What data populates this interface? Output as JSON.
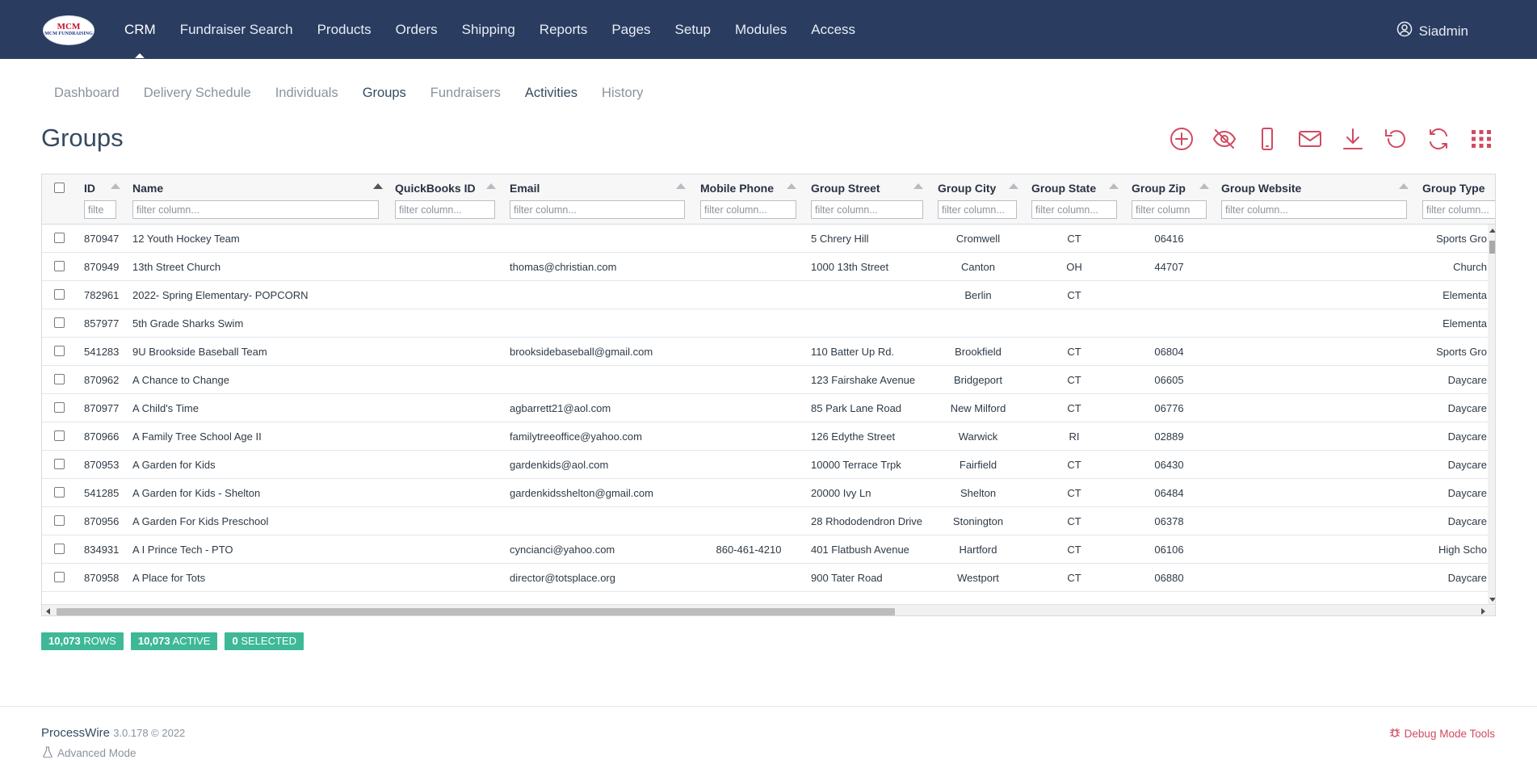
{
  "topnav": {
    "logo_text": "MCM FUNDRAISING",
    "items": [
      "CRM",
      "Fundraiser Search",
      "Products",
      "Orders",
      "Shipping",
      "Reports",
      "Pages",
      "Setup",
      "Modules",
      "Access"
    ],
    "user": "Siadmin"
  },
  "subnav": {
    "items": [
      "Dashboard",
      "Delivery Schedule",
      "Individuals",
      "Groups",
      "Fundraisers",
      "Activities",
      "History"
    ]
  },
  "page": {
    "title": "Groups"
  },
  "toolbar": {
    "icons": [
      "add-icon",
      "hide-icon",
      "mobile-icon",
      "email-icon",
      "download-icon",
      "undo-icon",
      "refresh-icon",
      "grid-icon"
    ]
  },
  "table": {
    "columns": [
      {
        "label": "ID",
        "placeholder": "filte"
      },
      {
        "label": "Name",
        "placeholder": "filter column..."
      },
      {
        "label": "QuickBooks ID",
        "placeholder": "filter column..."
      },
      {
        "label": "Email",
        "placeholder": "filter column..."
      },
      {
        "label": "Mobile Phone",
        "placeholder": "filter column..."
      },
      {
        "label": "Group Street",
        "placeholder": "filter column..."
      },
      {
        "label": "Group City",
        "placeholder": "filter column..."
      },
      {
        "label": "Group State",
        "placeholder": "filter column..."
      },
      {
        "label": "Group Zip",
        "placeholder": "filter column"
      },
      {
        "label": "Group Website",
        "placeholder": "filter column..."
      },
      {
        "label": "Group Type",
        "placeholder": "filter column..."
      }
    ],
    "rows": [
      [
        "870947",
        "12 Youth Hockey Team",
        "",
        "",
        "",
        "5 Chrery Hill",
        "Cromwell",
        "CT",
        "06416",
        "",
        "Sports Gro"
      ],
      [
        "870949",
        "13th Street Church",
        "",
        "thomas@christian.com",
        "",
        "1000 13th Street",
        "Canton",
        "OH",
        "44707",
        "",
        "Church"
      ],
      [
        "782961",
        "2022- Spring Elementary- POPCORN",
        "",
        "",
        "",
        "",
        "Berlin",
        "CT",
        "",
        "",
        "Elementa"
      ],
      [
        "857977",
        "5th Grade Sharks Swim",
        "",
        "",
        "",
        "",
        "",
        "",
        "",
        "",
        "Elementa"
      ],
      [
        "541283",
        "9U Brookside Baseball Team",
        "",
        "brooksidebaseball@gmail.com",
        "",
        "110 Batter Up Rd.",
        "Brookfield",
        "CT",
        "06804",
        "",
        "Sports Gro"
      ],
      [
        "870962",
        "A Chance to Change",
        "",
        "",
        "",
        "123 Fairshake Avenue",
        "Bridgeport",
        "CT",
        "06605",
        "",
        "Daycare"
      ],
      [
        "870977",
        "A Child's Time",
        "",
        "agbarrett21@aol.com",
        "",
        "85 Park Lane Road",
        "New Milford",
        "CT",
        "06776",
        "",
        "Daycare"
      ],
      [
        "870966",
        "A Family Tree School Age II",
        "",
        "familytreeoffice@yahoo.com",
        "",
        "126 Edythe Street",
        "Warwick",
        "RI",
        "02889",
        "",
        "Daycare"
      ],
      [
        "870953",
        "A Garden for Kids",
        "",
        "gardenkids@aol.com",
        "",
        "10000 Terrace Trpk",
        "Fairfield",
        "CT",
        "06430",
        "",
        "Daycare"
      ],
      [
        "541285",
        "A Garden for Kids - Shelton",
        "",
        "gardenkidsshelton@gmail.com",
        "",
        "20000 Ivy Ln",
        "Shelton",
        "CT",
        "06484",
        "",
        "Daycare"
      ],
      [
        "870956",
        "A Garden For Kids Preschool",
        "",
        "",
        "",
        "28 Rhododendron Drive",
        "Stonington",
        "CT",
        "06378",
        "",
        "Daycare"
      ],
      [
        "834931",
        "A I Prince Tech - PTO",
        "",
        "cyncianci@yahoo.com",
        "860-461-4210",
        "401 Flatbush Avenue",
        "Hartford",
        "CT",
        "06106",
        "",
        "High Scho"
      ],
      [
        "870958",
        "A Place for Tots",
        "",
        "director@totsplace.org",
        "",
        "900 Tater Road",
        "Westport",
        "CT",
        "06880",
        "",
        "Daycare"
      ]
    ]
  },
  "badges": [
    {
      "count": "10,073",
      "label": "ROWS"
    },
    {
      "count": "10,073",
      "label": "ACTIVE"
    },
    {
      "count": "0",
      "label": "SELECTED"
    }
  ],
  "footer": {
    "brand": "ProcessWire",
    "version": "3.0.178 © 2022",
    "advanced": "Advanced Mode",
    "debug": "Debug Mode Tools"
  },
  "colors": {
    "nav_bg": "#2a3c5f",
    "accent": "#d14a61",
    "badge": "#3eb897"
  }
}
